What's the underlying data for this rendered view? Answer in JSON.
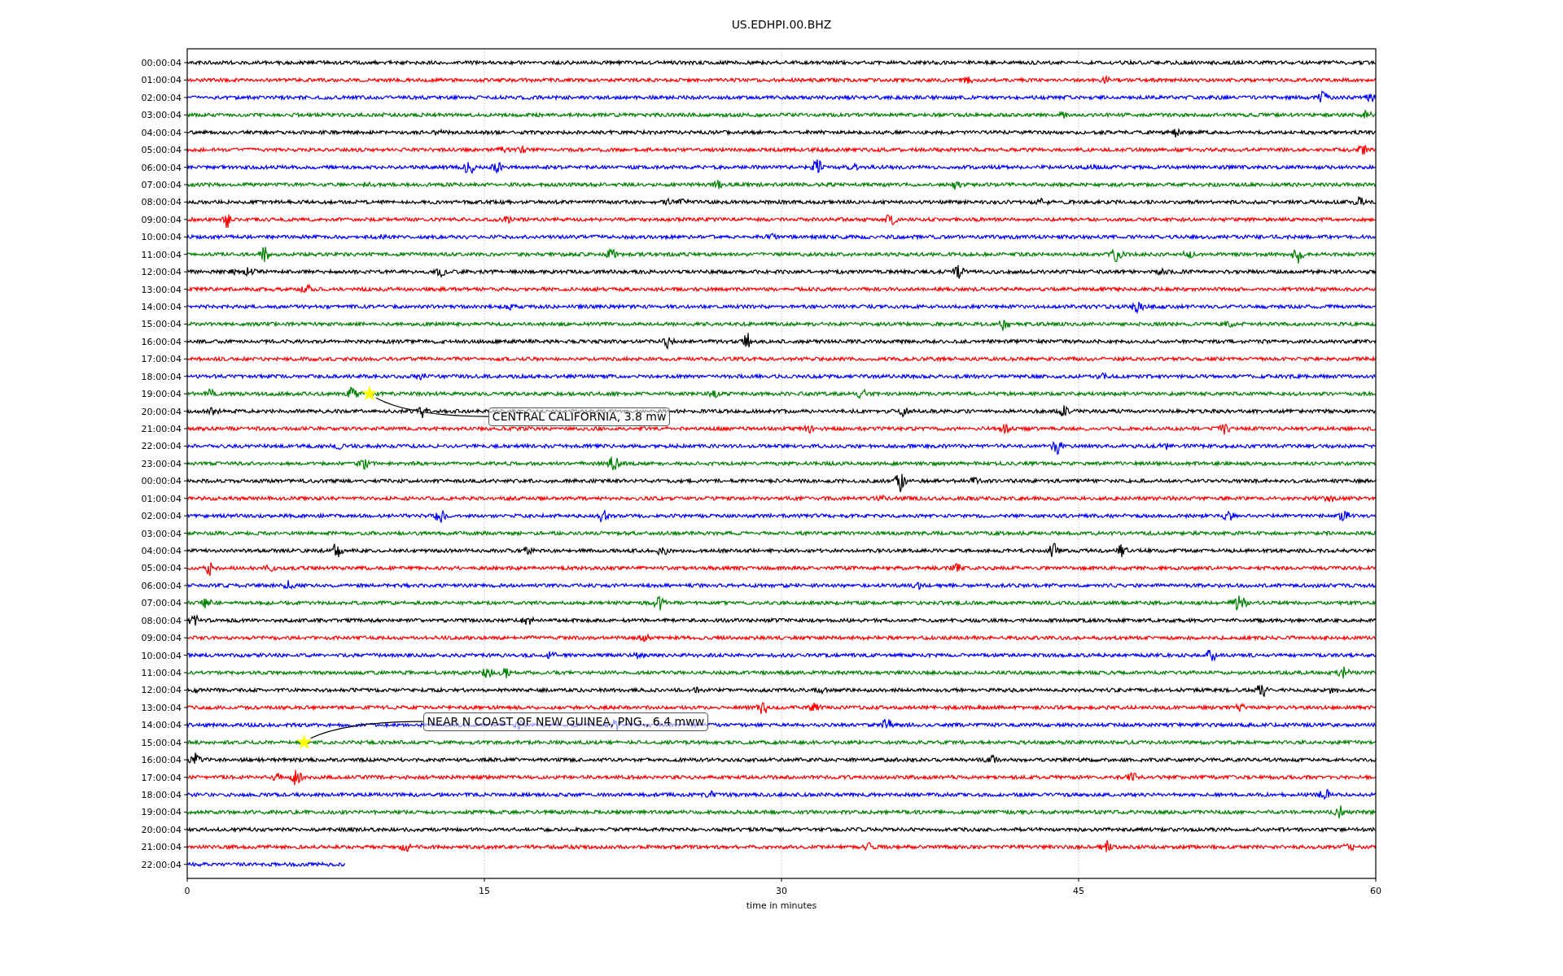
{
  "title": "US.EDHPI.00.BHZ",
  "row_labels": [
    "00:00:04",
    "01:00:04",
    "02:00:04",
    "03:00:04",
    "04:00:04",
    "05:00:04",
    "06:00:04",
    "07:00:04",
    "08:00:04",
    "09:00:04",
    "10:00:04",
    "11:00:04",
    "12:00:04",
    "13:00:04",
    "14:00:04",
    "15:00:04",
    "16:00:04",
    "17:00:04",
    "18:00:04",
    "19:00:04",
    "20:00:04",
    "21:00:04",
    "22:00:04",
    "23:00:04",
    "00:00:04",
    "01:00:04",
    "02:00:04",
    "03:00:04",
    "04:00:04",
    "05:00:04",
    "06:00:04",
    "07:00:04",
    "08:00:04",
    "09:00:04",
    "10:00:04",
    "11:00:04",
    "12:00:04",
    "13:00:04",
    "14:00:04",
    "15:00:04",
    "16:00:04",
    "17:00:04",
    "18:00:04",
    "19:00:04",
    "20:00:04",
    "21:00:04",
    "22:00:04"
  ],
  "x_ticks": [
    "0",
    "15",
    "30",
    "45",
    "60"
  ],
  "xlabel": "time in minutes",
  "annotations": [
    "CENTRAL CALIFORNIA, 3.8 mw",
    "NEAR N COAST OF NEW GUINEA, PNG., 6.4 mww"
  ],
  "traces": [
    {
      "color": "#000000",
      "level": 1
    },
    {
      "color": "#ff0000",
      "level": 1
    },
    {
      "color": "#0000ff",
      "level": 1
    },
    {
      "color": "#008000",
      "level": 1
    },
    {
      "color": "#000000",
      "level": 1
    },
    {
      "color": "#ff0000",
      "level": 1
    },
    {
      "color": "#0000ff",
      "level": 1
    },
    {
      "color": "#008000",
      "level": 1
    },
    {
      "color": "#000000",
      "level": 1
    },
    {
      "color": "#ff0000",
      "level": 1
    },
    {
      "color": "#0000ff",
      "level": 1
    },
    {
      "color": "#008000",
      "level": 1
    },
    {
      "color": "#000000",
      "level": 1
    },
    {
      "color": "#ff0000",
      "level": 1
    },
    {
      "color": "#0000ff",
      "level": 1
    },
    {
      "color": "#008000",
      "level": 1
    },
    {
      "color": "#000000",
      "level": 1
    },
    {
      "color": "#ff0000",
      "level": 1
    },
    {
      "color": "#0000ff",
      "level": 1
    },
    {
      "color": "#008000",
      "level": 1
    },
    {
      "color": "#000000",
      "level": 1
    },
    {
      "color": "#ff0000",
      "level": 1
    },
    {
      "color": "#0000ff",
      "level": 1
    },
    {
      "color": "#008000",
      "level": 1
    },
    {
      "color": "#000000",
      "level": 1
    },
    {
      "color": "#ff0000",
      "level": 1
    },
    {
      "color": "#0000ff",
      "level": 1
    },
    {
      "color": "#008000",
      "level": 1
    },
    {
      "color": "#000000",
      "level": 1
    },
    {
      "color": "#ff0000",
      "level": 1
    },
    {
      "color": "#0000ff",
      "level": 1
    },
    {
      "color": "#008000",
      "level": 1
    },
    {
      "color": "#000000",
      "level": 1
    },
    {
      "color": "#ff0000",
      "level": 1
    },
    {
      "color": "#0000ff",
      "level": 1
    },
    {
      "color": "#008000",
      "level": 1
    },
    {
      "color": "#000000",
      "level": 1
    },
    {
      "color": "#ff0000",
      "level": 1
    },
    {
      "color": "#0000ff",
      "level": 1
    },
    {
      "color": "#008000",
      "level": 1
    },
    {
      "color": "#000000",
      "level": 1
    },
    {
      "color": "#ff0000",
      "level": 1
    },
    {
      "color": "#0000ff",
      "level": 1
    },
    {
      "color": "#008000",
      "level": 1
    },
    {
      "color": "#000000",
      "level": 1
    },
    {
      "color": "#ff0000",
      "level": 1
    },
    {
      "color": "#0000ff",
      "level": 0.133
    }
  ]
}
